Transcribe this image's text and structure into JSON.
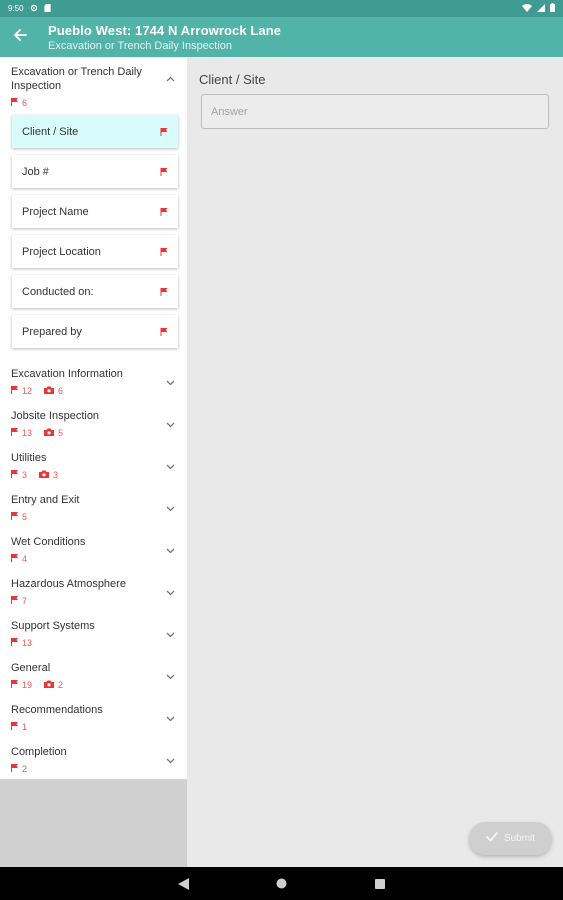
{
  "status_bar": {
    "time": "9:50",
    "icons": [
      "gear-icon",
      "sd-card-icon",
      "wifi-icon",
      "signal-icon",
      "battery-icon"
    ]
  },
  "app_bar": {
    "title": "Pueblo West: 1744 N Arrowrock Lane",
    "subtitle": "Excavation or Trench Daily Inspection",
    "back_icon": "arrow-left-icon",
    "color": "#52b3a9"
  },
  "sidebar": {
    "expanded_section": {
      "title": "Excavation or Trench Daily Inspection",
      "flag_count": "6",
      "items": [
        {
          "label": "Client / Site",
          "active": true
        },
        {
          "label": "Job #"
        },
        {
          "label": "Project Name"
        },
        {
          "label": "Project Location"
        },
        {
          "label": "Conducted on:"
        },
        {
          "label": "Prepared by"
        }
      ]
    },
    "sections": [
      {
        "title": "Excavation Information",
        "flags": "12",
        "photos": "6"
      },
      {
        "title": "Jobsite Inspection",
        "flags": "13",
        "photos": "5"
      },
      {
        "title": "Utilities",
        "flags": "3",
        "photos": "3"
      },
      {
        "title": "Entry and Exit",
        "flags": "5"
      },
      {
        "title": "Wet Conditions",
        "flags": "4"
      },
      {
        "title": "Hazardous Atmosphere",
        "flags": "7"
      },
      {
        "title": "Support Systems",
        "flags": "13"
      },
      {
        "title": "General",
        "flags": "19",
        "photos": "2"
      },
      {
        "title": "Recommendations",
        "flags": "1"
      },
      {
        "title": "Completion",
        "flags": "2"
      }
    ]
  },
  "main": {
    "question_label": "Client / Site",
    "answer_placeholder": "Answer",
    "answer_value": ""
  },
  "fab": {
    "label": "Submit",
    "icon": "check-icon"
  },
  "nav_bar": {
    "icons": [
      "nav-back-icon",
      "nav-home-icon",
      "nav-recents-icon"
    ]
  },
  "colors": {
    "accent": "#52b3a9",
    "flag": "#e53935",
    "active_item": "#d8fbfb"
  }
}
